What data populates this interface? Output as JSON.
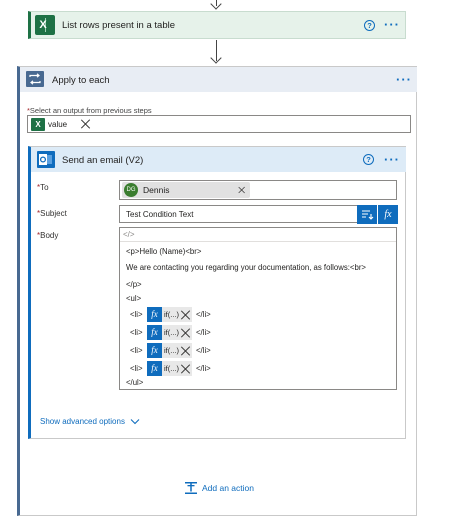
{
  "top_action": {
    "title": "List rows present in a table",
    "help_icon": "?",
    "more_label": "···"
  },
  "apply_to_each": {
    "title": "Apply to each",
    "more_label": "···",
    "select_label_req": "*",
    "select_label": "Select an output from previous steps",
    "token_label": "value"
  },
  "send_email": {
    "title": "Send an email (V2)",
    "help_icon": "?",
    "more_label": "···",
    "to_label": "To",
    "to_chip_initials": "DG",
    "to_chip_name": "Dennis",
    "subject_label": "Subject",
    "subject_value": "Test Condition Text",
    "body_label": "Body",
    "code_toggle": "</>",
    "body_lines": {
      "l1": "<p>Hello (Name)<br>",
      "l2": "We are contacting you regarding your documentation, as follows:<br>",
      "l3": "</p>",
      "l4": "<ul>",
      "l5": "</ul>"
    },
    "list_items": [
      {
        "open": "<li>",
        "expr": "if(...)",
        "close": "</li>"
      },
      {
        "open": "<li>",
        "expr": "if(...)",
        "close": "</li>"
      },
      {
        "open": "<li>",
        "expr": "if(...)",
        "close": "</li>"
      },
      {
        "open": "<li>",
        "expr": "if(...)",
        "close": "</li>"
      }
    ],
    "fx_label": "fx",
    "advanced_label": "Show advanced options",
    "required_mark": "*"
  },
  "add_action_label": "Add an action",
  "colors": {
    "excel_green": "#1e7145",
    "loop_blue": "#486991",
    "outlook_blue": "#0f6cbd",
    "required_red": "#a4262c"
  },
  "icons": [
    "excel-icon",
    "loop-icon",
    "outlook-icon",
    "help-icon",
    "more-icon",
    "close-icon",
    "dynamic-content-icon",
    "expression-icon",
    "chevron-down-icon",
    "add-action-icon"
  ]
}
